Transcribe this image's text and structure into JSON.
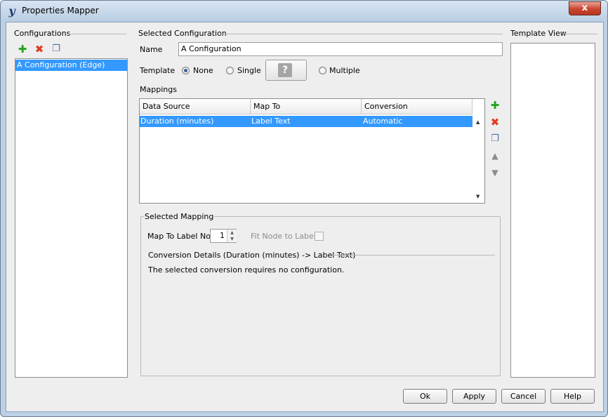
{
  "window": {
    "title": "Properties Mapper",
    "close_glyph": "x"
  },
  "configurations": {
    "heading": "Configurations",
    "items": [
      "A Configuration (Edge)"
    ]
  },
  "selected_configuration": {
    "heading": "Selected Configuration",
    "name_label": "Name",
    "name_value": "A Configuration",
    "template_label": "Template",
    "template_options": [
      "None",
      "Single",
      "Multiple"
    ],
    "template_selected": "None",
    "placeholder_glyph": "?"
  },
  "mappings": {
    "heading": "Mappings",
    "columns": [
      "Data Source",
      "Map To",
      "Conversion"
    ],
    "rows": [
      {
        "data_source": "Duration (minutes)",
        "map_to": "Label Text",
        "conversion": "Automatic"
      }
    ]
  },
  "selected_mapping": {
    "heading": "Selected Mapping",
    "map_to_label_no_label": "Map To Label No.",
    "map_to_label_no_value": "1",
    "fit_node_label": "Fit Node to Label",
    "conversion_details_heading": "Conversion Details (Duration (minutes) -> Label Text)",
    "conversion_message": "The selected conversion requires no configuration."
  },
  "template_view": {
    "heading": "Template View"
  },
  "buttons": {
    "ok": "Ok",
    "apply": "Apply",
    "cancel": "Cancel",
    "help": "Help"
  },
  "icons": {
    "add": "plus-icon",
    "delete": "delete-icon",
    "copy": "copy-icon",
    "up": "arrow-up-icon",
    "down": "arrow-down-icon",
    "app": "yed-logo-icon"
  },
  "colors": {
    "selection": "#3399ff",
    "add_green": "#22a31e",
    "delete_red": "#e23b1d",
    "close_red": "#c9452f"
  }
}
